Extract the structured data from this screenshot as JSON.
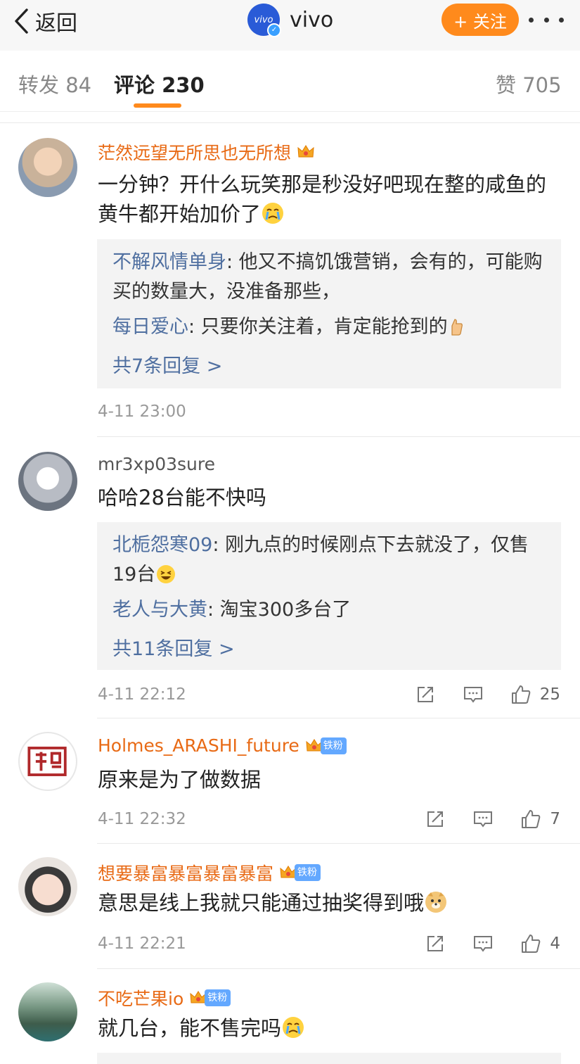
{
  "header": {
    "back_label": "返回",
    "account_name": "vivo",
    "logo_text": "vivo",
    "follow_label": "+ 关注"
  },
  "tabs": [
    {
      "label": "转发 84"
    },
    {
      "label": "评论 230"
    },
    {
      "label": "赞 705"
    }
  ],
  "colors": {
    "accent": "#ff8a1c",
    "link_blue": "#4f6fa0",
    "username_orange": "#e86a15"
  },
  "comments": [
    {
      "username": "茫然远望无所思也无所想",
      "text": "一分钟？开什么玩笑那是秒没好吧现在整的咸鱼的黄牛都开始加价了",
      "emoji": "crying-emoji",
      "replies": [
        {
          "name": "不解风情单身",
          "text": ": 他又不搞饥饿营销，会有的，可能购买的数量大，没准备那些，"
        },
        {
          "name": "每日爱心",
          "text": ": 只要你关注着，肯定能抢到的",
          "emoji": "thumbs-up-emoji"
        }
      ],
      "more_replies": "共7条回复 >",
      "time": "4-11 23:00"
    },
    {
      "username": "mr3xp03sure",
      "text": "哈哈28台能不快吗",
      "replies": [
        {
          "name": "北栀怨寒09",
          "text": ": 刚九点的时候刚点下去就没了，仅售19台",
          "emoji": "laughing-emoji"
        },
        {
          "name": "老人与大黄",
          "text": ": 淘宝300多台了"
        }
      ],
      "more_replies": "共11条回复 >",
      "time": "4-11 22:12",
      "likes": "25"
    },
    {
      "username": "Holmes_ARASHI_future",
      "badge": "铁粉",
      "text": "原来是为了做数据",
      "time": "4-11 22:32",
      "likes": "7"
    },
    {
      "username": "想要暴富暴富暴富暴富",
      "badge": "铁粉",
      "text": "意思是线上我就只能通过抽奖得到哦",
      "emoji": "doge-emoji",
      "time": "4-11 22:21",
      "likes": "4"
    },
    {
      "username": "不吃芒果io",
      "badge": "铁粉",
      "text": "就几台，能不售完吗",
      "emoji": "crying-emoji"
    }
  ]
}
